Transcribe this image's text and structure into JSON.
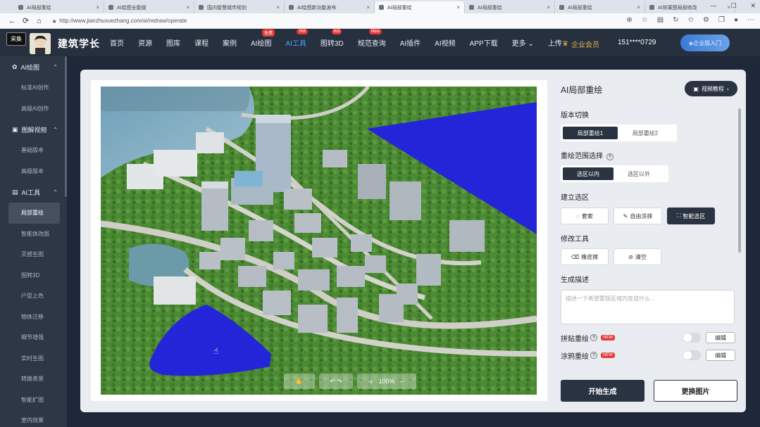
{
  "browser": {
    "tabs": [
      {
        "label": "AI局部重绘"
      },
      {
        "label": "AI绘图全能版"
      },
      {
        "label": "国内智慧城市规划"
      },
      {
        "label": "AI绘图新功能发布"
      },
      {
        "label": "AI局部重绘",
        "active": true
      },
      {
        "label": "AI局部重绘"
      },
      {
        "label": "AI局部重绘"
      },
      {
        "label": "AI效果图局部修改"
      }
    ],
    "url": "http://www.jianzhuxuezhang.com/ai/redraw/operate",
    "window_controls": [
      "—",
      "☐",
      "✕"
    ]
  },
  "topnav": {
    "collect_label": "采集",
    "brand": "建筑学长",
    "items": [
      {
        "label": "首页"
      },
      {
        "label": "资源"
      },
      {
        "label": "图库"
      },
      {
        "label": "课程"
      },
      {
        "label": "案例"
      },
      {
        "label": "AI绘图",
        "badge": "免费"
      },
      {
        "label": "AI工具",
        "badge": "Hot",
        "active": true
      },
      {
        "label": "图转3D",
        "badge": "hot"
      },
      {
        "label": "规范查询",
        "badge": "New"
      },
      {
        "label": "AI插件"
      },
      {
        "label": "AI视频"
      },
      {
        "label": "APP下载"
      },
      {
        "label": "更多"
      },
      {
        "label": "上传"
      }
    ],
    "member_label": "企业会员",
    "phone": "151****0729",
    "enterprise_label": "企业版入门"
  },
  "sidebar": {
    "groups": [
      {
        "label": "AI绘图",
        "icon": "palette-icon",
        "items": [
          "标准AI创作",
          "高级AI创作"
        ]
      },
      {
        "label": "图解视频",
        "icon": "video-icon",
        "items": [
          "基础版本",
          "高级版本"
        ]
      },
      {
        "label": "AI工具",
        "icon": "toolbox-icon",
        "items": [
          "局部重绘",
          "智能体改图",
          "灵感生图",
          "图转3D",
          "户型上色",
          "物体迁移",
          "细节增强",
          "实时生图",
          "转换表景",
          "智能扩图",
          "室内效果"
        ]
      }
    ],
    "active_item": "局部重绘"
  },
  "canvas": {
    "zoom": "100%"
  },
  "panel": {
    "title": "AI局部重绘",
    "video_button": "视频教程",
    "version_label": "版本切换",
    "version_options": [
      "局部重绘1",
      "局部重绘2"
    ],
    "version_selected": 0,
    "range_label": "重绘范围选择",
    "range_options": [
      "选区以内",
      "选区以外"
    ],
    "range_selected": 0,
    "selection_label": "建立选区",
    "selection_tools": [
      "套索",
      "自由涂抹",
      "智能选区"
    ],
    "selection_active": 2,
    "modify_label": "修改工具",
    "modify_tools": [
      "橡皮擦",
      "清空"
    ],
    "desc_label": "生成描述",
    "desc_placeholder": "描述一下希望蒙版区域内变成什么...",
    "options": [
      {
        "label": "拼贴重绘",
        "badge": "NEW",
        "edit": "编辑",
        "on": false
      },
      {
        "label": "涂鸦重绘",
        "badge": "NEW",
        "edit": "编辑",
        "on": false
      }
    ],
    "start_button": "开始生成",
    "change_button": "更换图片"
  },
  "colors": {
    "accent_dark": "#2a3341",
    "mask_blue": "#2424d8",
    "hot_red": "#e53935",
    "member_gold": "#e8b04a"
  }
}
